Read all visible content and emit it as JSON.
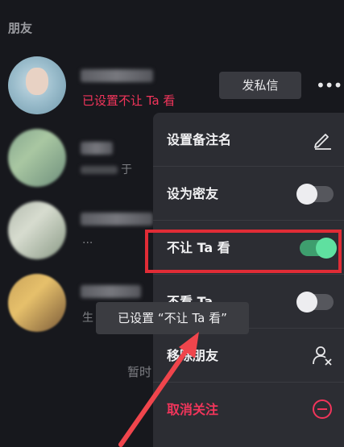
{
  "section_title": "朋友",
  "friend1": {
    "status": "已设置不让 Ta 看",
    "dm_label": "发私信",
    "more_label": "•••"
  },
  "friend2": {
    "sub_fragment": "于"
  },
  "friend3": {
    "sub_fragment": "..."
  },
  "friend4": {
    "sub_fragment": "生"
  },
  "empty_hint": "暂时",
  "menu": {
    "items": [
      {
        "label": "设置备注名",
        "icon": "pencil-icon"
      },
      {
        "label": "设为密友",
        "toggle": "off"
      },
      {
        "label": "不让 Ta 看",
        "toggle": "on"
      },
      {
        "label": "不看 Ta",
        "toggle": "off"
      },
      {
        "label": "移除朋友",
        "icon": "remove-user-icon"
      },
      {
        "label": "取消关注",
        "icon": "minus-circle-icon"
      }
    ]
  },
  "toast": "已设置 “不让 Ta 看”",
  "colors": {
    "accent_red": "#f2355b",
    "toggle_on": "#5fe0a0",
    "highlight": "#e12c36"
  }
}
